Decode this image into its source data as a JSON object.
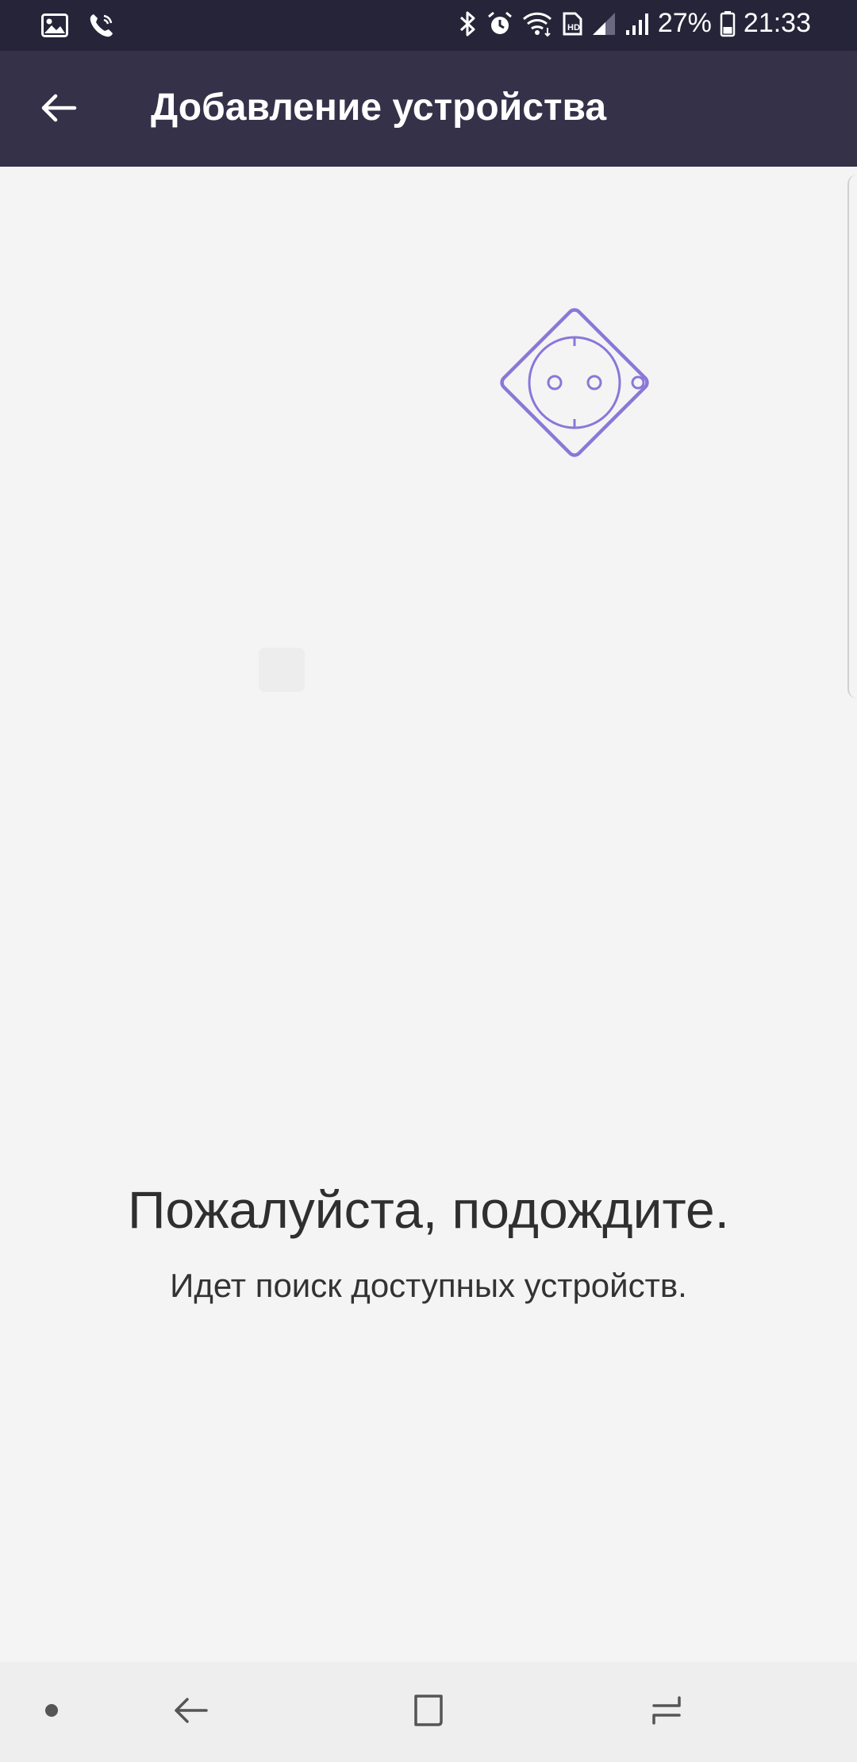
{
  "status_bar": {
    "battery": "27%",
    "time": "21:33",
    "left_icons": [
      "gallery-icon",
      "call-icon"
    ],
    "right_icons": [
      "bluetooth-icon",
      "alarm-icon",
      "wifi-icon",
      "hd-icon",
      "signal-icon",
      "signal-icon",
      "battery-icon"
    ]
  },
  "app_bar": {
    "title": "Добавление устройства",
    "back_icon": "arrow-left-icon"
  },
  "content": {
    "illustration_icon": "power-socket-icon",
    "title": "Пожалуйста, подождите.",
    "subtitle": "Идет поиск доступных устройств."
  },
  "nav_bar": {
    "items": [
      "menu-dot-icon",
      "back-icon",
      "home-icon",
      "recents-icon"
    ]
  },
  "colors": {
    "status_bar": "#262438",
    "app_bar": "#343149",
    "background": "#f4f4f4",
    "accent": "#8a77d8",
    "nav_bar": "#eeeeee"
  }
}
